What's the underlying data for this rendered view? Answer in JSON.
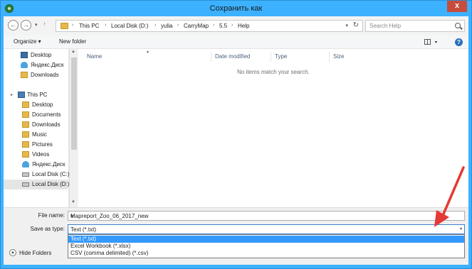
{
  "window": {
    "title": "Сохранить как",
    "close_label": "x"
  },
  "address_bar": {
    "crumbs": [
      "This PC",
      "Local Disk (D:)",
      "yulia",
      "CarryMap",
      "5.5",
      "Help"
    ]
  },
  "search": {
    "placeholder": "Search Help"
  },
  "toolbar": {
    "organize_label": "Organize ▾",
    "new_folder_label": "New folder"
  },
  "nav_pane": {
    "favorites": [
      {
        "label": "Desktop",
        "icon": "desktop-icon"
      },
      {
        "label": "Яндекс.Диск",
        "icon": "cloud-icon"
      },
      {
        "label": "Downloads",
        "icon": "downloads-icon"
      }
    ],
    "this_pc_label": "This PC",
    "this_pc_items": [
      {
        "label": "Desktop",
        "icon": "folder-icon"
      },
      {
        "label": "Documents",
        "icon": "folder-icon"
      },
      {
        "label": "Downloads",
        "icon": "folder-icon"
      },
      {
        "label": "Music",
        "icon": "folder-icon"
      },
      {
        "label": "Pictures",
        "icon": "folder-icon"
      },
      {
        "label": "Videos",
        "icon": "folder-icon"
      },
      {
        "label": "Яндекс.Диск",
        "icon": "cloud-icon"
      },
      {
        "label": "Local Disk (C:)",
        "icon": "disk-icon"
      },
      {
        "label": "Local Disk (D:)",
        "icon": "disk-icon"
      }
    ]
  },
  "file_list": {
    "columns": [
      "Name",
      "Date modified",
      "Type",
      "Size"
    ],
    "empty_message": "No items match your search."
  },
  "form": {
    "file_name_label": "File name:",
    "file_name_value": "Mapreport_Zoo_06_2017_new",
    "save_as_type_label": "Save as type:",
    "save_as_type_value": "Text (*.txt)",
    "save_as_type_options": [
      "Text (*.txt)",
      "Excel Workbook (*.xlsx)",
      "CSV (comma delimited) (*.csv)"
    ],
    "hide_folders_label": "Hide Folders"
  },
  "colors": {
    "accent": "#3cb1ff",
    "selection": "#3399ff",
    "annotation_arrow": "#e53935"
  }
}
